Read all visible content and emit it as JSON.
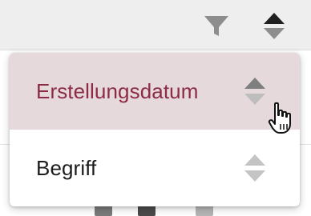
{
  "toolbar": {
    "filter_icon": "filter-icon",
    "sort_icon": "sort-icon"
  },
  "menu": {
    "items": [
      {
        "label": "Erstellungsdatum",
        "active": true,
        "icon": "sort-icon"
      },
      {
        "label": "Begriff",
        "active": false,
        "icon": "sort-icon"
      }
    ]
  },
  "colors": {
    "accent_text": "#8c2b45",
    "active_bg": "#e6d9dc",
    "toolbar_bg": "#eeeeee",
    "icon_gray": "#9e9e9e",
    "icon_dark": "#616161"
  }
}
